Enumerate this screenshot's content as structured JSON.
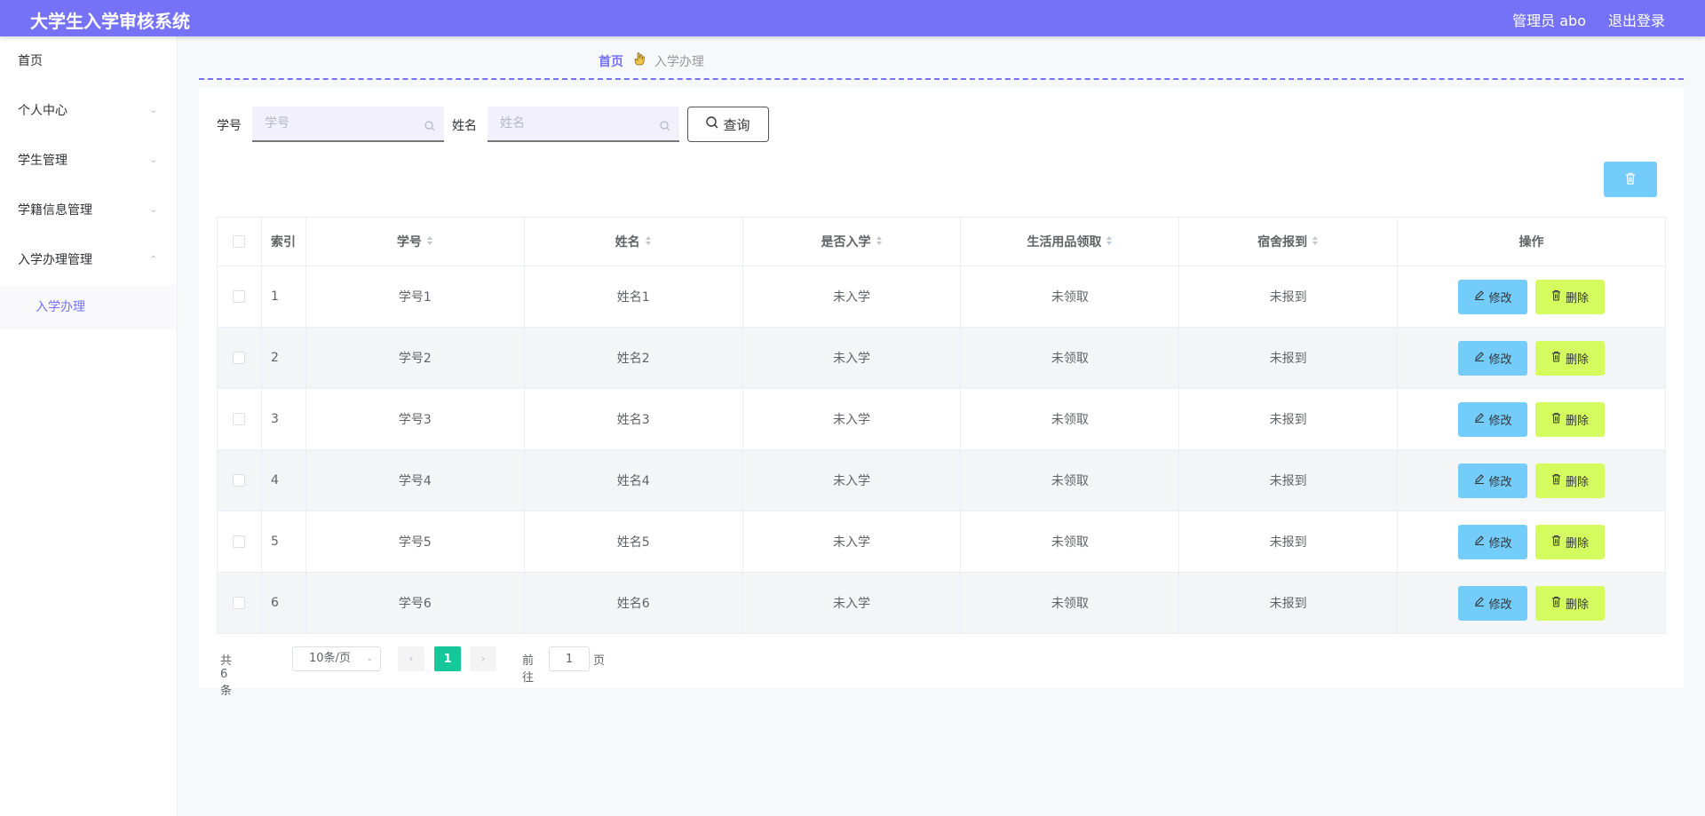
{
  "header": {
    "app_title": "大学生入学审核系统",
    "user": "管理员 abo",
    "logout": "退出登录"
  },
  "sidebar": {
    "items": [
      {
        "label": "首页"
      },
      {
        "label": "个人中心"
      },
      {
        "label": "学生管理"
      },
      {
        "label": "学籍信息管理"
      },
      {
        "label": "入学办理管理"
      }
    ],
    "sub_item": "入学办理"
  },
  "breadcrumb": {
    "home": "首页",
    "current": "入学办理"
  },
  "search": {
    "student_no_label": "学号",
    "student_no_placeholder": "学号",
    "name_label": "姓名",
    "name_placeholder": "姓名",
    "query_button": "查询"
  },
  "table": {
    "headers": [
      "索引",
      "学号",
      "姓名",
      "是否入学",
      "生活用品领取",
      "宿舍报到",
      "操作"
    ],
    "rows": [
      {
        "index": "1",
        "student_no": "学号1",
        "name": "姓名1",
        "enrolled": "未入学",
        "supplies": "未领取",
        "dorm": "未报到"
      },
      {
        "index": "2",
        "student_no": "学号2",
        "name": "姓名2",
        "enrolled": "未入学",
        "supplies": "未领取",
        "dorm": "未报到"
      },
      {
        "index": "3",
        "student_no": "学号3",
        "name": "姓名3",
        "enrolled": "未入学",
        "supplies": "未领取",
        "dorm": "未报到"
      },
      {
        "index": "4",
        "student_no": "学号4",
        "name": "姓名4",
        "enrolled": "未入学",
        "supplies": "未领取",
        "dorm": "未报到"
      },
      {
        "index": "5",
        "student_no": "学号5",
        "name": "姓名5",
        "enrolled": "未入学",
        "supplies": "未领取",
        "dorm": "未报到"
      },
      {
        "index": "6",
        "student_no": "学号6",
        "name": "姓名6",
        "enrolled": "未入学",
        "supplies": "未领取",
        "dorm": "未报到"
      }
    ],
    "edit_label": "修改",
    "delete_label": "删除"
  },
  "pagination": {
    "total": "共 6 条",
    "page_size": "10条/页",
    "current_page": "1",
    "goto_prefix": "前往",
    "goto_value": "1",
    "goto_suffix": "页"
  },
  "colors": {
    "header_bg": "#7572f7",
    "edit_btn": "#74ccfb",
    "delete_btn": "#d4fc5e",
    "active_page": "#16c79a"
  }
}
